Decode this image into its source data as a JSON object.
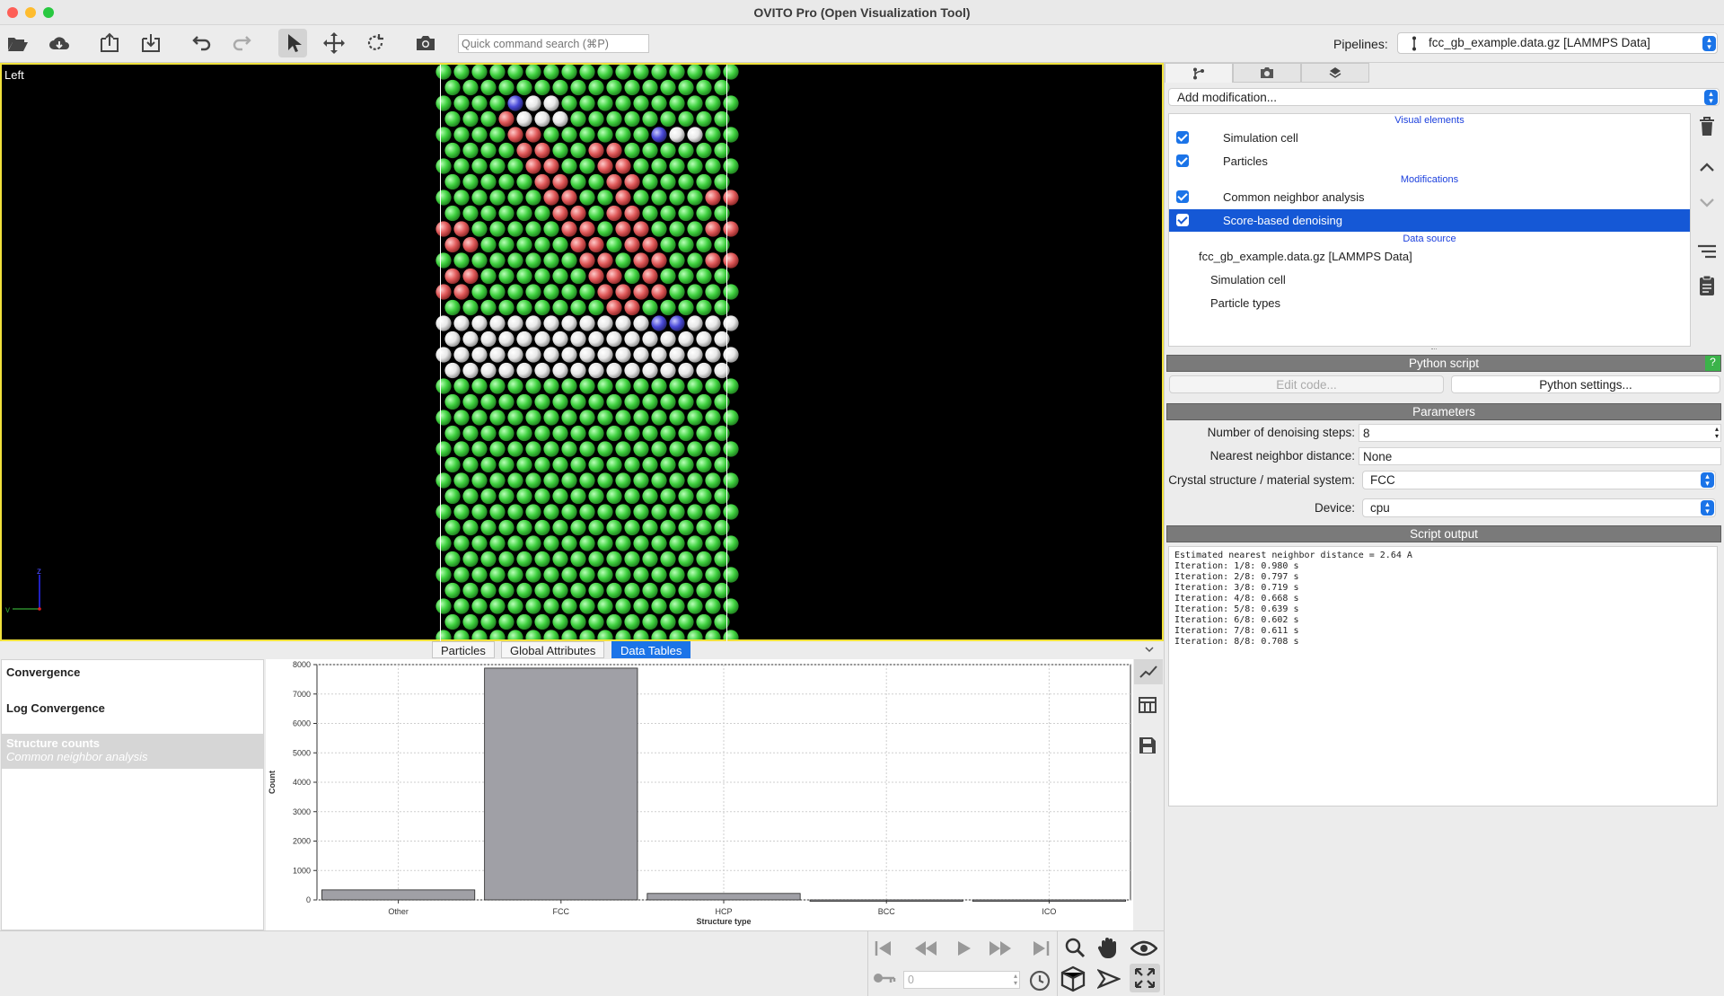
{
  "window": {
    "title": "OVITO Pro (Open Visualization Tool)"
  },
  "toolbar": {
    "search_placeholder": "Quick command search (⌘P)",
    "pipelines_label": "Pipelines:",
    "pipeline_selected": "fcc_gb_example.data.gz [LAMMPS Data]"
  },
  "viewport": {
    "label": "Left",
    "axis_z": "z",
    "axis_y": "y"
  },
  "bottom_tabs": [
    "Particles",
    "Global Attributes",
    "Data Tables"
  ],
  "data_tables": [
    {
      "title": "Convergence",
      "subtitle": ""
    },
    {
      "title": "Log Convergence",
      "subtitle": ""
    },
    {
      "title": "Structure counts",
      "subtitle": "Common neighbor analysis"
    }
  ],
  "chart_data": {
    "type": "bar",
    "categories": [
      "Other",
      "FCC",
      "HCP",
      "BCC",
      "ICO"
    ],
    "values": [
      340,
      7880,
      220,
      0,
      0
    ],
    "xlabel": "Structure type",
    "ylabel": "Count",
    "ylim": [
      0,
      8000
    ],
    "yticks": [
      0,
      1000,
      2000,
      3000,
      4000,
      5000,
      6000,
      7000,
      8000
    ],
    "grid": true,
    "bar_color": "#a0a0a6"
  },
  "animation": {
    "frame_value": "0"
  },
  "pipeline_editor": {
    "add_modification": "Add modification...",
    "categories": {
      "visual": "Visual elements",
      "modifications": "Modifications",
      "source": "Data source"
    },
    "visual_elements": [
      "Simulation cell",
      "Particles"
    ],
    "modifications": [
      "Common neighbor analysis",
      "Score-based denoising"
    ],
    "data_source": {
      "file": "fcc_gb_example.data.gz [LAMMPS Data]",
      "children": [
        "Simulation cell",
        "Particle types"
      ]
    }
  },
  "python_script": {
    "header": "Python script",
    "help": "?",
    "edit_code": "Edit code...",
    "settings": "Python settings..."
  },
  "parameters": {
    "header": "Parameters",
    "steps_label": "Number of denoising steps:",
    "steps_value": "8",
    "nn_label": "Nearest neighbor distance:",
    "nn_value": "None",
    "crystal_label": "Crystal structure / material system:",
    "crystal_value": "FCC",
    "device_label": "Device:",
    "device_value": "cpu"
  },
  "script_output": {
    "header": "Script output",
    "lines": [
      "Estimated nearest neighbor distance = 2.64 A",
      "Iteration: 1/8: 0.980 s",
      "Iteration: 2/8: 0.797 s",
      "Iteration: 3/8: 0.719 s",
      "Iteration: 4/8: 0.668 s",
      "Iteration: 5/8: 0.639 s",
      "Iteration: 6/8: 0.602 s",
      "Iteration: 7/8: 0.611 s",
      "Iteration: 8/8: 0.708 s"
    ]
  },
  "colors": {
    "accent": "#1b74e8",
    "fcc": "#3fd13f",
    "hcp": "#e05a5a",
    "other": "#e8e8e8",
    "bcc": "#4a4ad8",
    "viewport_border": "#f1e23c"
  }
}
